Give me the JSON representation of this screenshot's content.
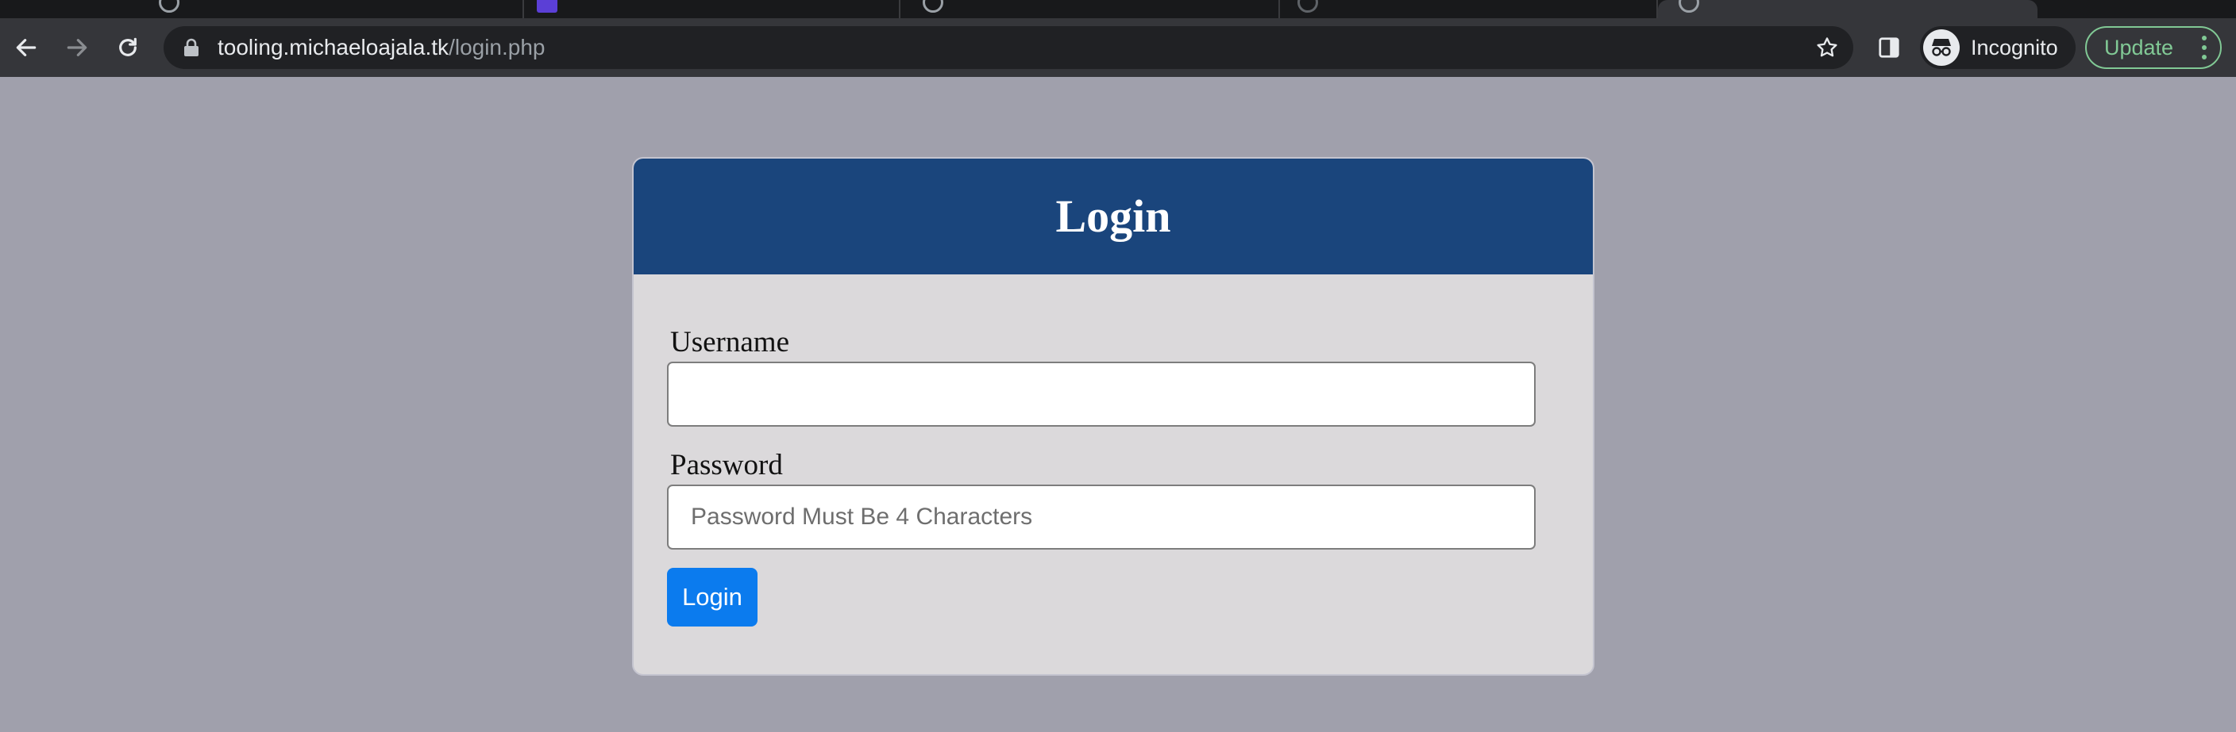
{
  "browser": {
    "url_host": "tooling.michaeloajala.tk",
    "url_path": "/login.php",
    "incognito_label": "Incognito",
    "update_label": "Update",
    "icons": {
      "back": "arrow-left-icon",
      "forward": "arrow-right-icon",
      "reload": "reload-icon",
      "lock": "lock-icon",
      "bookmark": "star-icon",
      "side_panel": "side-panel-icon",
      "incognito": "incognito-icon",
      "menu": "more-vertical-icon"
    },
    "colors": {
      "toolbar": "#35363a",
      "omnibox": "#202124",
      "update_accent": "#81c995"
    }
  },
  "login": {
    "title": "Login",
    "username_label": "Username",
    "username_value": "",
    "password_label": "Password",
    "password_placeholder": "Password Must Be 4 Characters",
    "submit_label": "Login",
    "colors": {
      "header": "#1a457c",
      "card": "#dbd9db",
      "button": "#0b7bee",
      "page_background": "#a0a0ac"
    }
  }
}
